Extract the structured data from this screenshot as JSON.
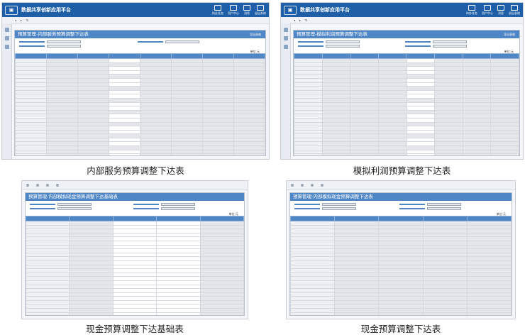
{
  "app": {
    "title": "数据共享创新应用平台",
    "top_icons": [
      {
        "label": "待办任务",
        "icon": "task-icon"
      },
      {
        "label": "用户中心",
        "icon": "user-icon"
      },
      {
        "label": "消息",
        "icon": "message-icon"
      },
      {
        "label": "退出系统",
        "icon": "logout-icon"
      }
    ]
  },
  "panels": [
    {
      "caption": "内部服务预算调整下达表",
      "form_title": "预算管理-内部服务预算调整下达表",
      "action": "导出表格"
    },
    {
      "caption": "模拟利润预算调整下达表",
      "form_title": "预算管理-模拟利润预算调整下达表",
      "action": "导出表格"
    },
    {
      "caption": "现金预算调整下达基础表",
      "form_title": "预算管理-内部模拟现金预算调整下达基础表",
      "action": ""
    },
    {
      "caption": "现金预算调整下达表",
      "form_title": "预算管理-内部模拟现金预算调整下达表",
      "action": ""
    }
  ],
  "unit_label": "单位:元"
}
